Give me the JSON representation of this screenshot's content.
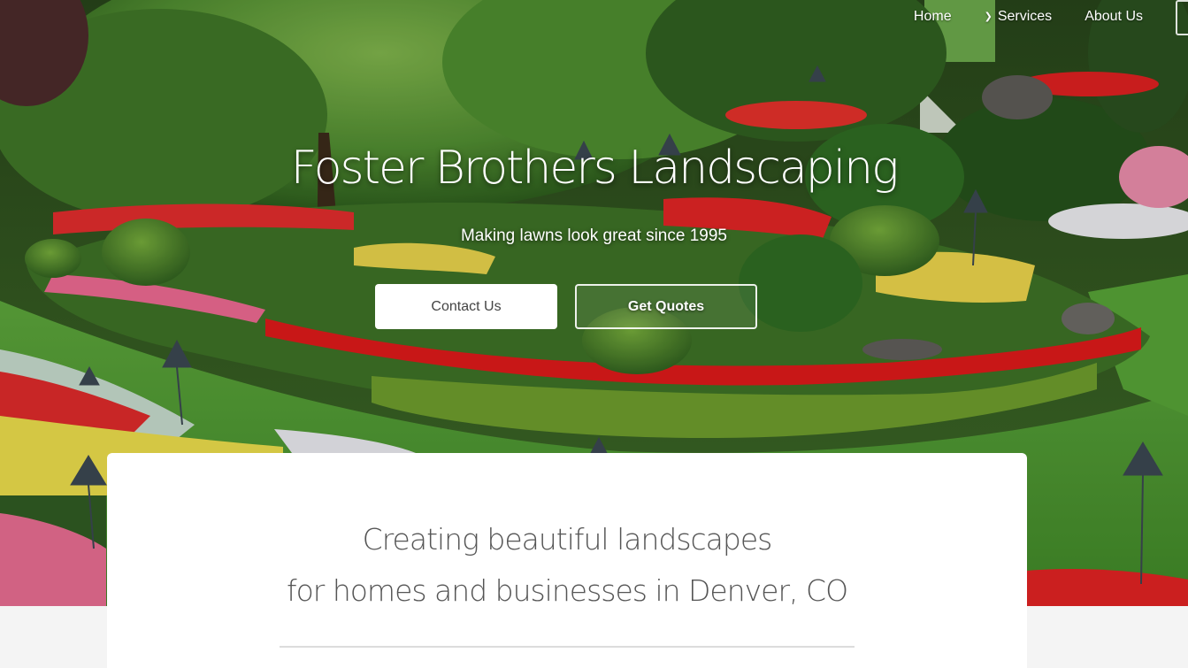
{
  "nav": {
    "items": [
      {
        "label": "Home"
      },
      {
        "label": "Services",
        "has_dropdown": true
      },
      {
        "label": "About Us"
      }
    ]
  },
  "hero": {
    "title": "Foster Brothers Landscaping",
    "subtitle": "Making lawns look great since 1995",
    "buttons": {
      "contact": "Contact Us",
      "quotes": "Get Quotes"
    },
    "background": "garden-photo"
  },
  "intro": {
    "line1": "Creating beautiful landscapes",
    "line2": "for homes and businesses in Denver, CO"
  },
  "colors": {
    "lawn": "#4f8f2f",
    "foliage": "#2f5a22",
    "flowers_red": "#d92020",
    "flowers_yellow": "#e9d64a",
    "flowers_pink": "#e56a8f",
    "card": "#ffffff",
    "text": "#555555"
  }
}
